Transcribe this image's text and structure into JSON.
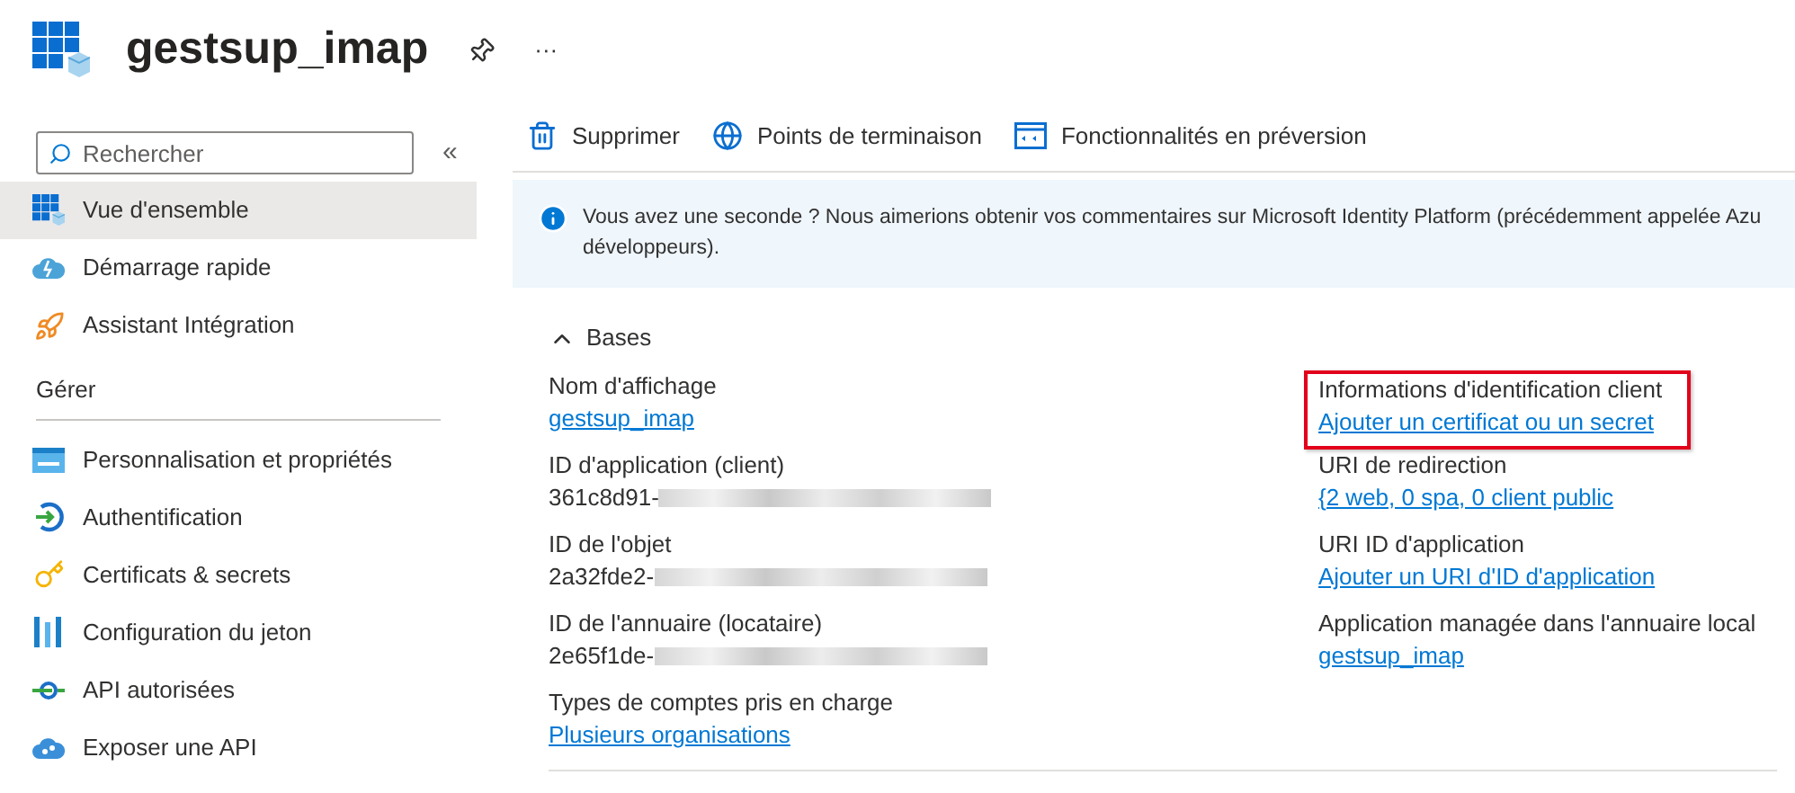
{
  "header": {
    "title": "gestsup_imap",
    "more": "···"
  },
  "sidebar": {
    "search": {
      "placeholder": "Rechercher"
    },
    "collapse": "«",
    "items": [
      {
        "label": "Vue d'ensemble",
        "kind": "grid",
        "selected": true
      },
      {
        "label": "Démarrage rapide",
        "kind": "cloud",
        "selected": false
      },
      {
        "label": "Assistant Intégration",
        "kind": "rocket",
        "selected": false
      }
    ],
    "section": "Gérer",
    "manage_items": [
      {
        "label": "Personnalisation et propriétés",
        "kind": "card",
        "selected": false
      },
      {
        "label": "Authentification",
        "kind": "auth",
        "selected": false
      },
      {
        "label": "Certificats & secrets",
        "kind": "key",
        "selected": false
      },
      {
        "label": "Configuration du jeton",
        "kind": "bars",
        "selected": false
      },
      {
        "label": "API autorisées",
        "kind": "api",
        "selected": false
      },
      {
        "label": "Exposer une API",
        "kind": "cloudapi",
        "selected": false
      }
    ]
  },
  "toolbar": [
    {
      "label": "Supprimer",
      "kind": "trash"
    },
    {
      "label": "Points de terminaison",
      "kind": "globe"
    },
    {
      "label": "Fonctionnalités en préversion",
      "kind": "preview"
    }
  ],
  "banner": {
    "lines": [
      "Vous avez une seconde ? Nous aimerions obtenir vos commentaires sur Microsoft Identity Platform (précédemment appelée Azu",
      "développeurs)."
    ]
  },
  "essentials": {
    "title": "Bases",
    "expanded": true,
    "left": [
      {
        "label": "Nom d'affichage",
        "value": "gestsup_imap",
        "kind": "link",
        "masked": false,
        "highlighted": false
      },
      {
        "label": "ID d'application (client)",
        "value": "361c8d91-",
        "kind": "text",
        "masked": true,
        "highlighted": false
      },
      {
        "label": "ID de l'objet",
        "value": "2a32fde2-",
        "kind": "text",
        "masked": true,
        "highlighted": false
      },
      {
        "label": "ID de l'annuaire (locataire)",
        "value": "2e65f1de-",
        "kind": "text",
        "masked": true,
        "highlighted": false
      },
      {
        "label": "Types de comptes pris en charge",
        "value": "Plusieurs organisations",
        "kind": "link",
        "masked": false,
        "highlighted": false
      }
    ],
    "right": [
      {
        "label": "Informations d'identification client",
        "value": "Ajouter un certificat ou un secret",
        "kind": "link",
        "masked": false,
        "highlighted": true
      },
      {
        "label": "URI de redirection",
        "value": "{2 web, 0 spa, 0 client public",
        "kind": "link",
        "masked": false,
        "highlighted": false
      },
      {
        "label": "URI ID d'application",
        "value": "Ajouter un URI d'ID d'application",
        "kind": "link",
        "masked": false,
        "highlighted": false
      },
      {
        "label": "Application managée dans l'annuaire local",
        "value": "gestsup_imap",
        "kind": "link",
        "masked": false,
        "highlighted": false
      }
    ]
  }
}
